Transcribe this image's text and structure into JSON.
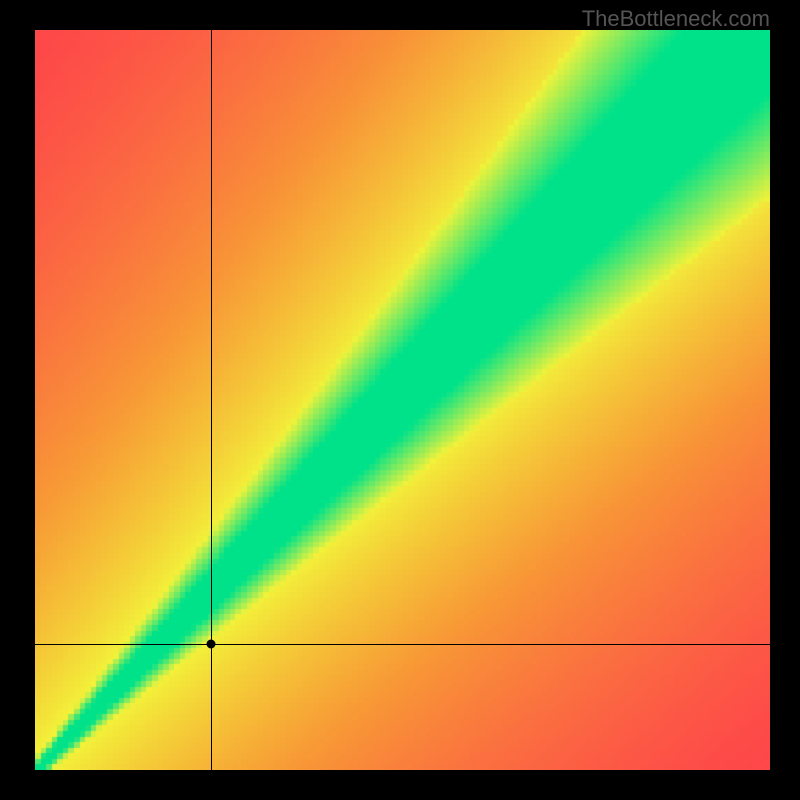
{
  "watermark": "TheBottleneck.com",
  "chart_data": {
    "type": "heatmap",
    "title": "",
    "xlabel": "",
    "ylabel": "",
    "x_range": [
      0,
      1
    ],
    "y_range": [
      0,
      1
    ],
    "crosshair": {
      "x": 0.24,
      "y": 0.17
    },
    "diagonal_band": {
      "description": "Green optimal band along diagonal from bottom-left to top-right, widening toward top-right, surrounded by yellow halo",
      "start": [
        0.0,
        0.0
      ],
      "end": [
        1.0,
        1.0
      ],
      "width_start": 0.01,
      "width_end": 0.15,
      "tilt": 0.1
    },
    "gradient_stops": {
      "optimal": "#00e28a",
      "near": "#f3f33a",
      "mid": "#f7a733",
      "far": "#ff3b4d"
    }
  }
}
